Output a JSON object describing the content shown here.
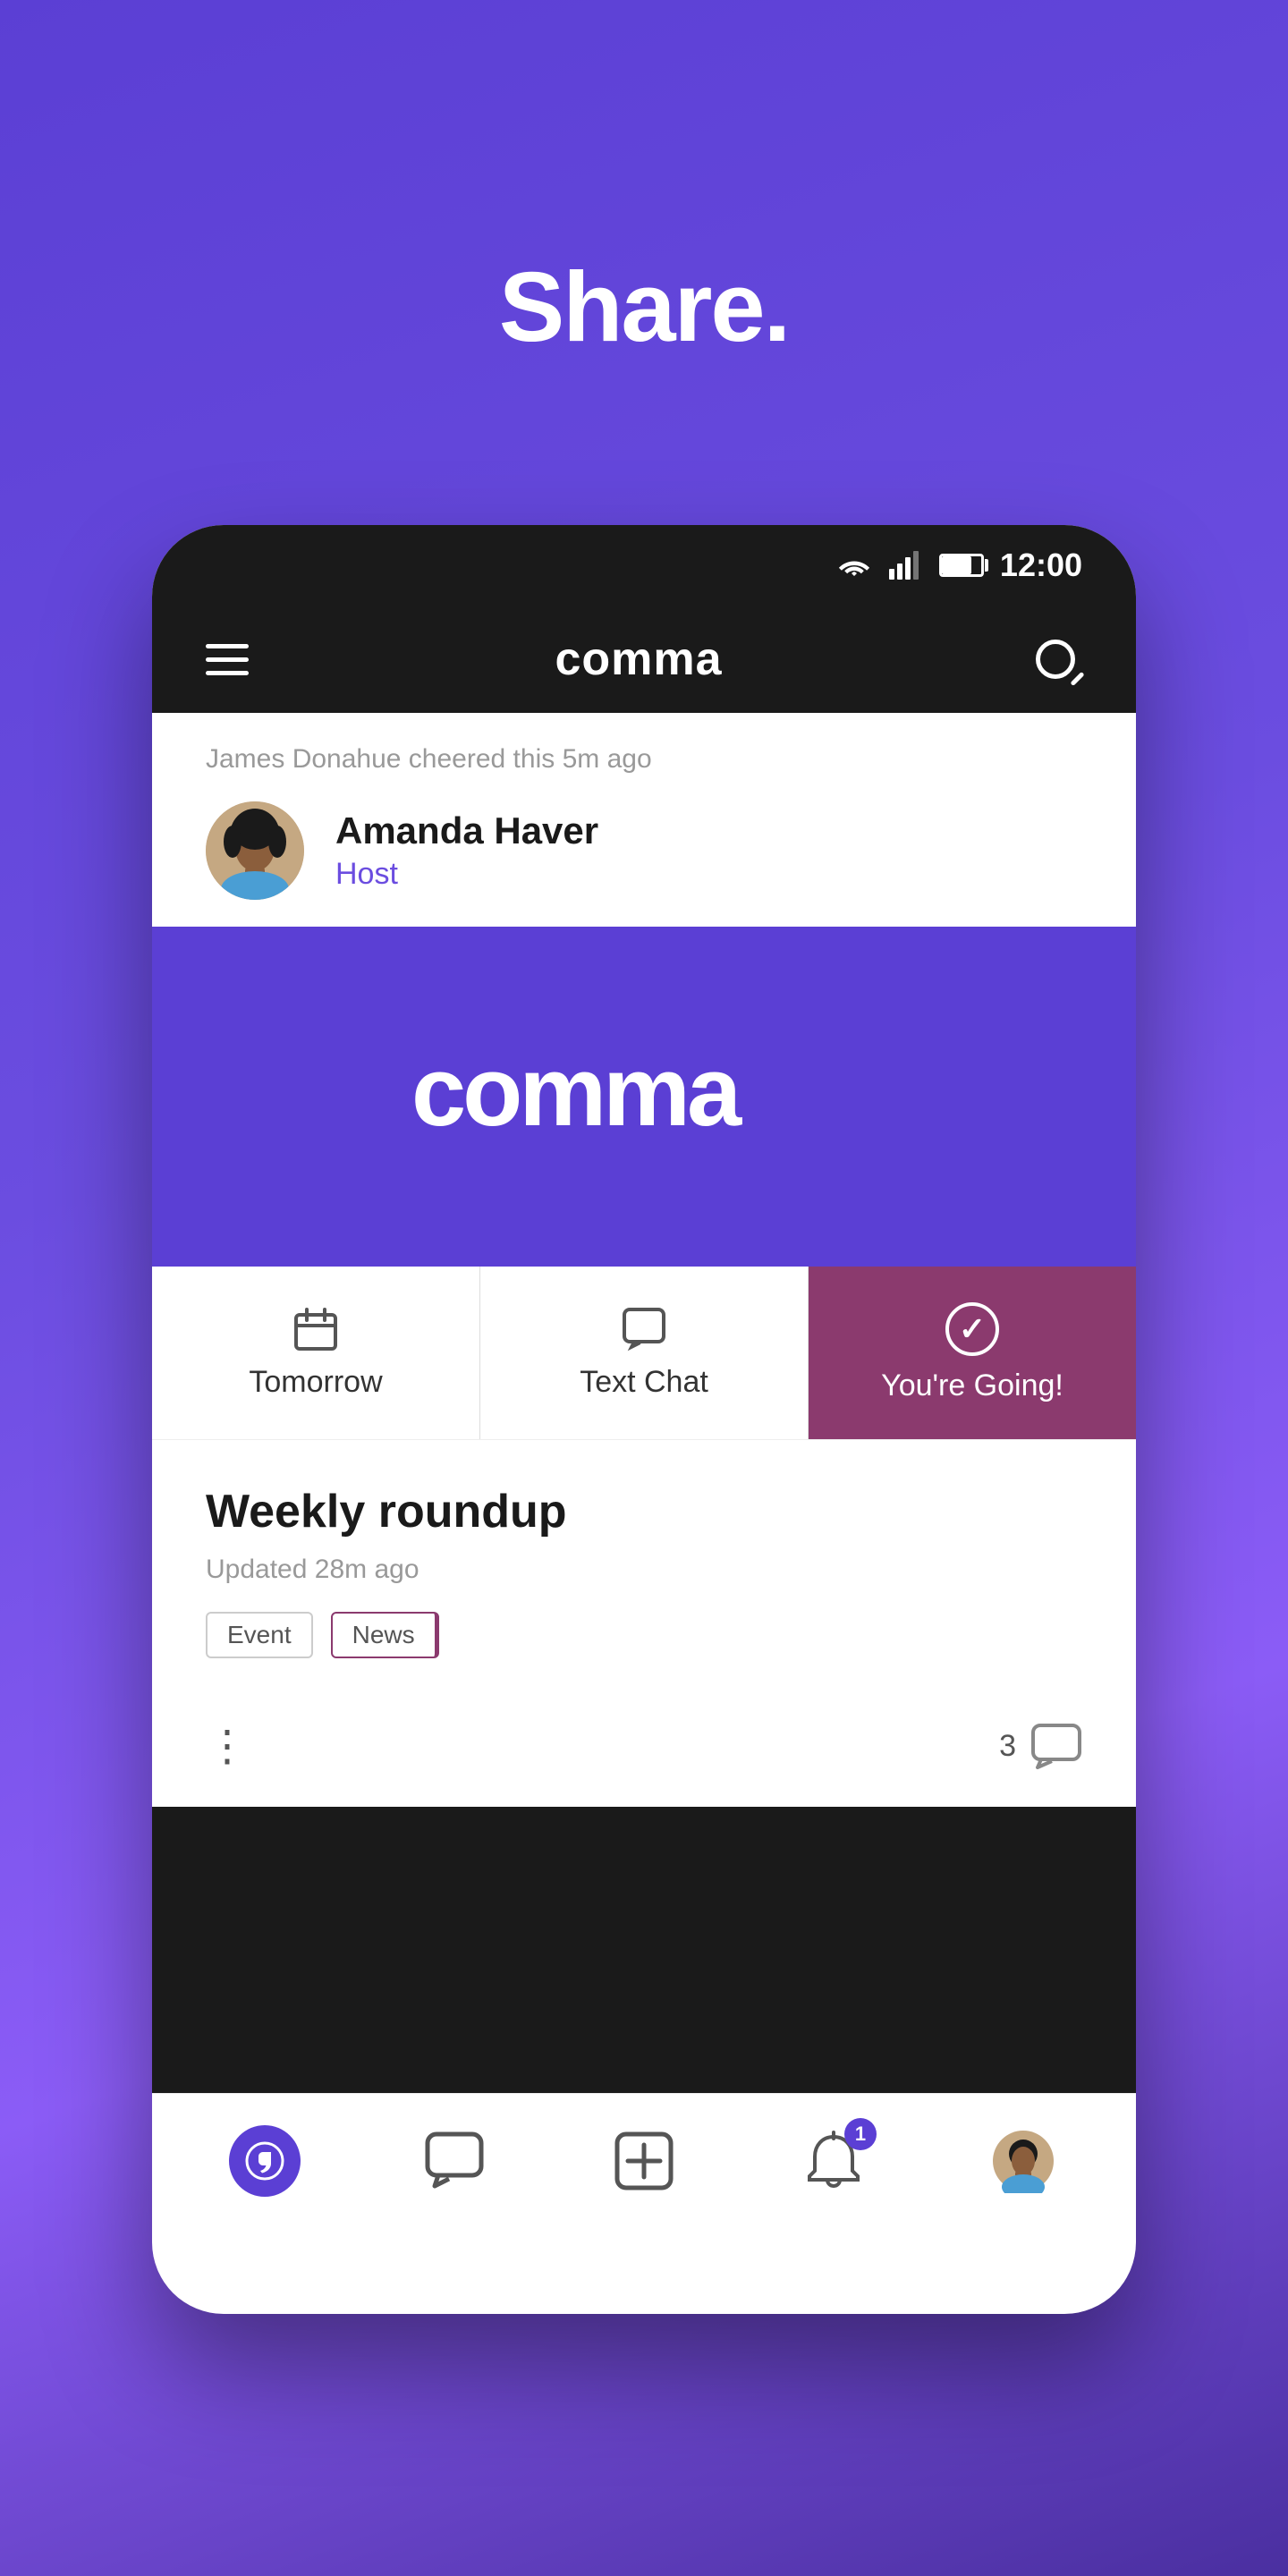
{
  "page": {
    "title": "Share.",
    "bg_color": "#5b3fd4"
  },
  "status_bar": {
    "time": "12:00"
  },
  "app_header": {
    "app_name": "comma",
    "search_label": "Search"
  },
  "notification": {
    "text": "James Donahue cheered this 5m ago"
  },
  "user": {
    "name": "Amanda Haver",
    "role": "Host"
  },
  "tabs": [
    {
      "id": "tomorrow",
      "label": "Tomorrow",
      "icon": "calendar",
      "active": false
    },
    {
      "id": "text-chat",
      "label": "Text Chat",
      "icon": "chat",
      "active": false
    },
    {
      "id": "youre-going",
      "label": "You're Going!",
      "icon": "check",
      "active": true
    }
  ],
  "post": {
    "title": "Weekly roundup",
    "updated": "Updated 28m ago",
    "tags": [
      "Event",
      "News"
    ],
    "comment_count": "3"
  },
  "bottom_nav": {
    "items": [
      {
        "id": "home",
        "label": "Home",
        "icon": "comma-circle"
      },
      {
        "id": "chat",
        "label": "Chat",
        "icon": "chat-bubble"
      },
      {
        "id": "add",
        "label": "Add",
        "icon": "plus"
      },
      {
        "id": "notifications",
        "label": "Notifications",
        "icon": "bell",
        "badge": "1"
      },
      {
        "id": "profile",
        "label": "Profile",
        "icon": "avatar"
      }
    ]
  }
}
